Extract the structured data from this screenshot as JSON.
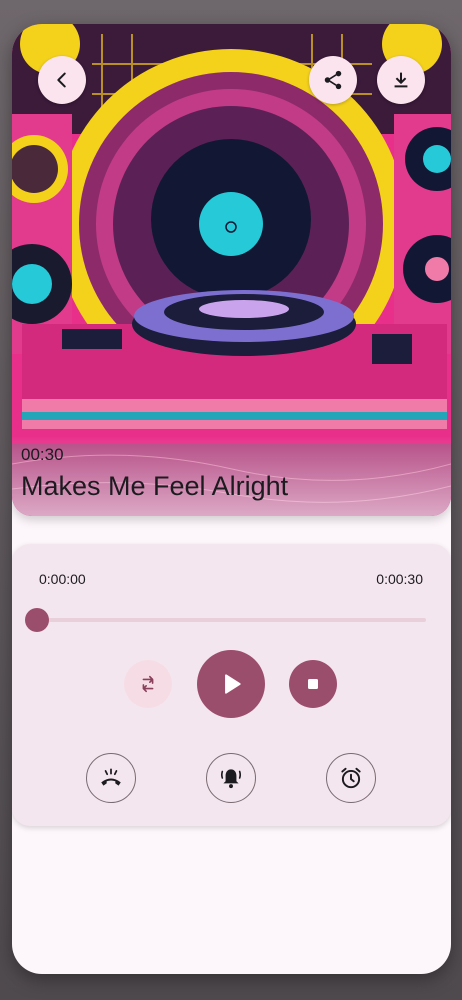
{
  "track": {
    "duration_label": "00:30",
    "title": "Makes Me Feel Alright"
  },
  "player": {
    "current_time": "0:00:00",
    "total_time": "0:00:30",
    "progress": 0.0
  },
  "icons": {
    "back": "chevron-left-icon",
    "share": "share-icon",
    "download": "download-icon",
    "repeat": "repeat-icon",
    "play": "play-icon",
    "stop": "stop-icon",
    "ringtone": "phone-ringing-icon",
    "notification": "bell-ringing-icon",
    "alarm": "alarm-clock-icon"
  },
  "colors": {
    "accent": "#9b4e6b",
    "card_bg": "#f4e6ee",
    "button_bg": "#fbe4ee"
  }
}
